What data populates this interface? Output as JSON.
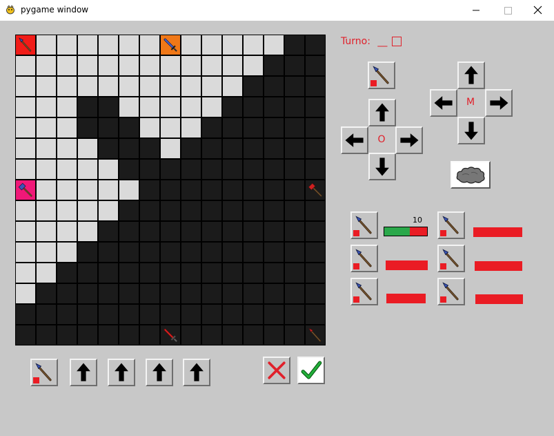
{
  "window": {
    "title": "pygame window"
  },
  "turn": {
    "label": "Turno:",
    "value": "__"
  },
  "movement_pad": {
    "center_label": "M"
  },
  "orientation_pad": {
    "center_label": "O"
  },
  "stats": {
    "hp_value": "10",
    "hp_fraction": 0.6
  },
  "colors": {
    "background": "#c8c8c8",
    "accent_red": "#ea1c24",
    "board_light": "#dadada",
    "board_dark": "#1b1b1b",
    "hp_green": "#2aa84a"
  },
  "board": {
    "size": 15,
    "rows": [
      "LLLLLLLLLLLLLDD",
      "LLLLLLLLLLLLDDD",
      "LLLLLLLLLLLDDDD",
      "LLLDDLLLLLDDDDD",
      "LLLDDDLLLDDDDDD",
      "LLLLDDDLDDDDDDD",
      "LLLLLDDDDDDDDDD",
      "LLLLLLDDDDDDDDD",
      "LLLLLDDDDDDDDDD",
      "LLLLDDDDDDDDDDD",
      "LLLDDDDDDDDDDDD",
      "LLDDDDDDDDDDDDD",
      "LDDDDDDDDDDDDDD",
      "DDDDDDDDDDDDDDD",
      "DDDDDDDDDDDDDDD"
    ],
    "pieces": [
      {
        "row": 0,
        "col": 0,
        "icon": "spear-icon",
        "bg": "#f01c18"
      },
      {
        "row": 0,
        "col": 7,
        "icon": "sword-icon",
        "bg": "#f07818"
      },
      {
        "row": 7,
        "col": 0,
        "icon": "hammer-icon",
        "bg": "#f01878"
      },
      {
        "row": 7,
        "col": 14,
        "icon": "enemy-hammer-icon",
        "bg": ""
      },
      {
        "row": 14,
        "col": 7,
        "icon": "enemy-sword-icon",
        "bg": ""
      },
      {
        "row": 14,
        "col": 14,
        "icon": "enemy-spear-icon",
        "bg": ""
      }
    ]
  }
}
